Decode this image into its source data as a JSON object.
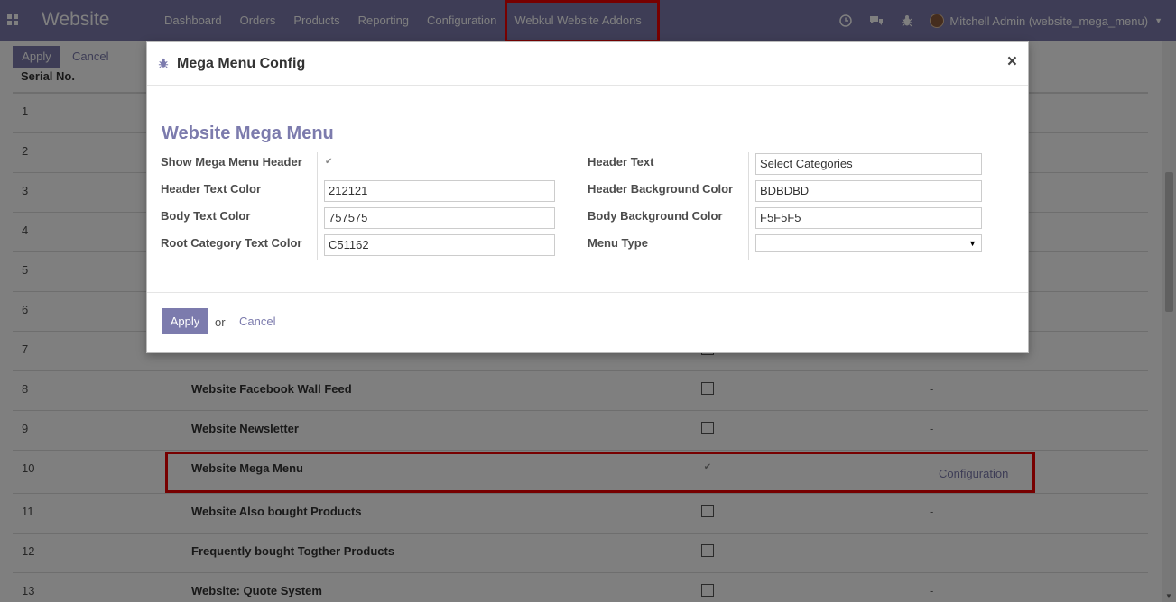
{
  "navbar": {
    "brand": "Website",
    "menu": [
      "Dashboard",
      "Orders",
      "Products",
      "Reporting",
      "Configuration",
      "Webkul Website Addons"
    ],
    "user": "Mitchell Admin (website_mega_menu)"
  },
  "control_panel": {
    "apply": "Apply",
    "cancel": "Cancel"
  },
  "table": {
    "header": "Serial No.",
    "rows": [
      {
        "serial": "1",
        "name": "",
        "checked": false,
        "config": ""
      },
      {
        "serial": "2",
        "name": "",
        "checked": false,
        "config": ""
      },
      {
        "serial": "3",
        "name": "",
        "checked": false,
        "config": ""
      },
      {
        "serial": "4",
        "name": "",
        "checked": false,
        "config": ""
      },
      {
        "serial": "5",
        "name": "",
        "checked": false,
        "config": ""
      },
      {
        "serial": "6",
        "name": "",
        "checked": false,
        "config": ""
      },
      {
        "serial": "7",
        "name": "",
        "checked": false,
        "config": ""
      },
      {
        "serial": "8",
        "name": "Website Facebook Wall Feed",
        "checked": false,
        "config": "-"
      },
      {
        "serial": "9",
        "name": "Website Newsletter",
        "checked": false,
        "config": "-"
      },
      {
        "serial": "10",
        "name": "Website Mega Menu",
        "checked": true,
        "config": "Configuration"
      },
      {
        "serial": "11",
        "name": "Website Also bought Products",
        "checked": false,
        "config": "-"
      },
      {
        "serial": "12",
        "name": "Frequently bought Togther Products",
        "checked": false,
        "config": "-"
      },
      {
        "serial": "13",
        "name": "Website: Quote System",
        "checked": false,
        "config": "-"
      }
    ]
  },
  "modal": {
    "title": "Mega Menu Config",
    "sheet_title": "Website Mega Menu",
    "labels": {
      "show_header": "Show Mega Menu Header",
      "header_text_color": "Header Text Color",
      "body_text_color": "Body Text Color",
      "root_category_color": "Root Category Text Color",
      "header_text": "Header Text",
      "header_bg_color": "Header Background Color",
      "body_bg_color": "Body Background Color",
      "menu_type": "Menu Type"
    },
    "values": {
      "show_header": true,
      "header_text_color": "212121",
      "body_text_color": "757575",
      "root_category_color": "C51162",
      "header_text": "Select Categories",
      "header_bg_color": "BDBDBD",
      "body_bg_color": "F5F5F5",
      "menu_type": ""
    },
    "apply": "Apply",
    "or": "or",
    "cancel": "Cancel"
  }
}
